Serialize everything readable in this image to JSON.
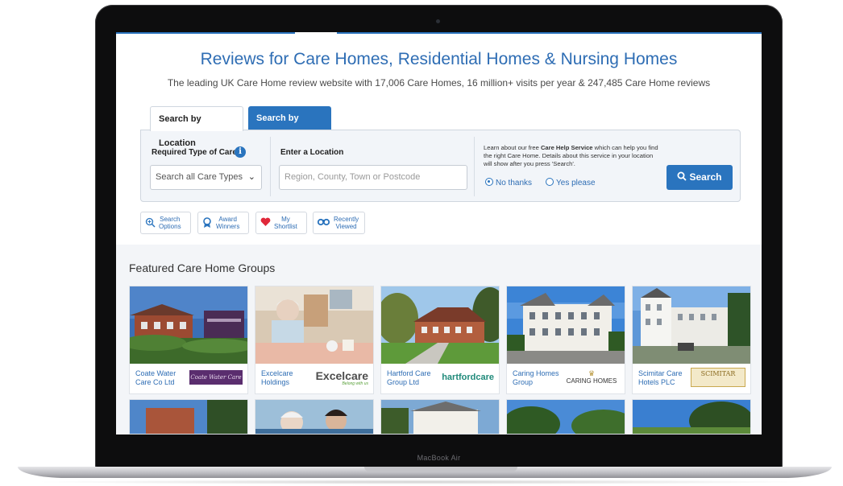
{
  "device": {
    "brand": "MacBook Air"
  },
  "page": {
    "title": "Reviews for Care Homes, Residential Homes & Nursing Homes",
    "subtitle": "The leading UK Care Home review website with 17,006 Care Homes, 16 million+ visits per year & 247,485 Care Home reviews"
  },
  "tabs": [
    {
      "label": "Search by Location",
      "active": true
    },
    {
      "label": "Search by Name",
      "active": false
    }
  ],
  "search": {
    "care_label": "Required Type of Care",
    "care_value": "Search all Care Types",
    "location_label": "Enter a Location",
    "location_placeholder": "Region, County, Town or Postcode",
    "help_pre": "Learn about our free ",
    "help_bold": "Care Help Service",
    "help_post": " which can help you find the right Care Home. Details about this service in your location will show after you press 'Search'.",
    "radio_no": "No thanks",
    "radio_yes": "Yes please",
    "button": "Search"
  },
  "quick_links": [
    {
      "line1": "Search",
      "line2": "Options",
      "icon": "search-plus-icon"
    },
    {
      "line1": "Award",
      "line2": "Winners",
      "icon": "award-icon"
    },
    {
      "line1": "My",
      "line2": "Shortlist",
      "icon": "heart-icon"
    },
    {
      "line1": "Recently",
      "line2": "Viewed",
      "icon": "binoculars-icon"
    }
  ],
  "featured": {
    "title": "Featured Care Home Groups",
    "cards": [
      {
        "name": "Coate Water Care Co Ltd",
        "logo": "Coate Water Care"
      },
      {
        "name": "Excelcare Holdings",
        "logo": "Excelcare",
        "logo_tag": "Belong with us"
      },
      {
        "name": "Hartford Care Group Ltd",
        "logo": "hartfordcare"
      },
      {
        "name": "Caring Homes Group",
        "logo": "CARING HOMES"
      },
      {
        "name": "Scimitar Care Hotels PLC",
        "logo": "SCIMITAR"
      }
    ]
  },
  "colors": {
    "brand": "#2a74be",
    "title": "#2e6db4",
    "heart": "#e0283a"
  }
}
